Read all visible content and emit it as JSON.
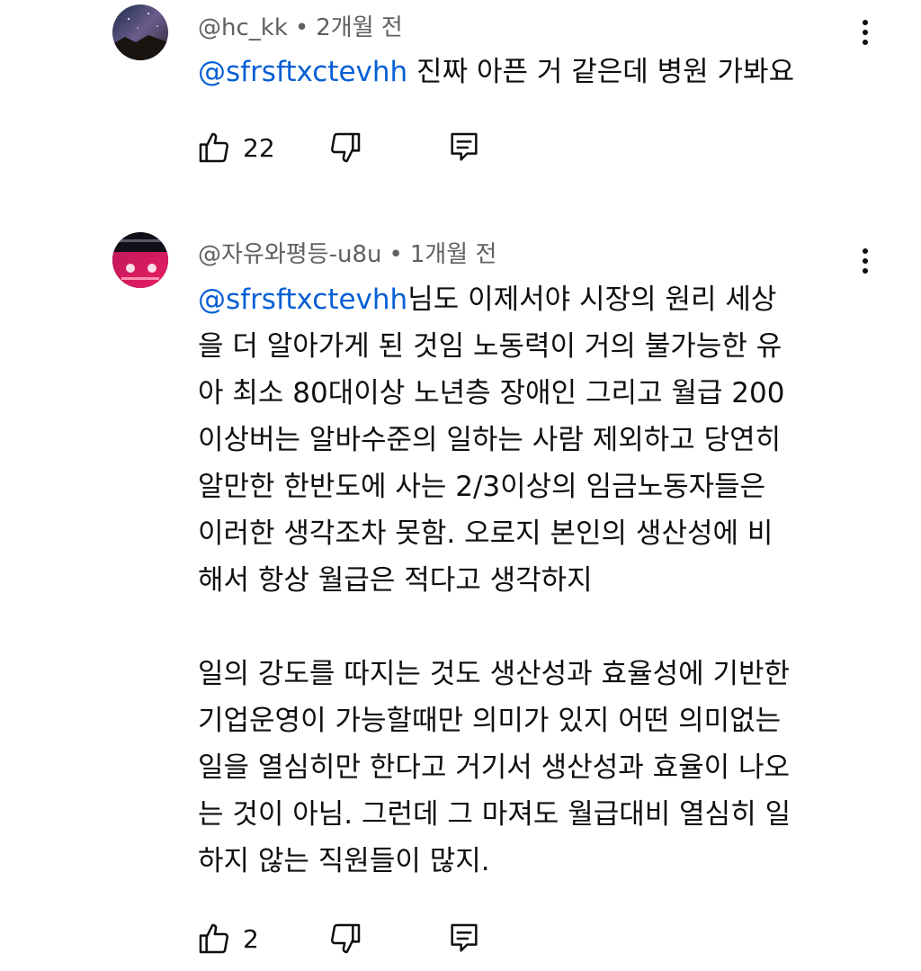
{
  "comments": [
    {
      "author": "@hc_kk",
      "time": "2개월 전",
      "mention": "@sfrsftxctevhh",
      "text_lines": [
        " 진짜 아픈 거 같은데 병원 가봐요"
      ],
      "like_count": "22",
      "icons": [
        "thumb-up-icon",
        "thumb-down-icon",
        "reply-icon",
        "more-vert-icon"
      ]
    },
    {
      "author": "@자유와평등-u8u",
      "time": "1개월 전",
      "mention": "@sfrsftxctevhh",
      "text_lines": [
        "님도 이제서야 시장의 원리 세상",
        "을 더 알아가게 된 것임 노동력이 거의 불가능한 유",
        "아 최소 80대이상 노년층 장애인 그리고 월급 200",
        "이상버는 알바수준의 일하는 사람 제외하고 당연히",
        "알만한 한반도에 사는 2/3이상의 임금노동자들은",
        "이러한 생각조차 못함. 오로지 본인의 생산성에 비",
        "해서 항상 월급은 적다고 생각하지",
        "",
        "일의 강도를 따지는 것도 생산성과 효율성에 기반한",
        "기업운영이 가능할때만 의미가 있지 어떤 의미없는",
        "일을 열심히만 한다고 거기서 생산성과 효율이 나오",
        "는 것이 아님. 그런데 그 마져도 월급대비 열심히 일",
        "하지 않는 직원들이 많지."
      ],
      "like_count": "2",
      "icons": [
        "thumb-up-icon",
        "thumb-down-icon",
        "reply-icon",
        "more-vert-icon"
      ]
    }
  ],
  "separator": "•"
}
